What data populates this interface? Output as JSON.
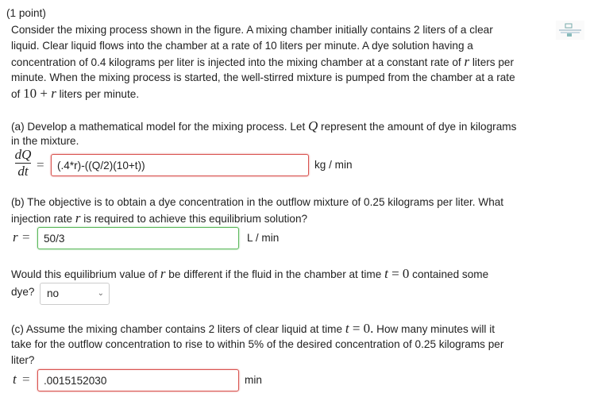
{
  "header": "(1 point)",
  "intro": [
    "Consider the mixing process shown in the figure. A mixing chamber initially contains 2 liters of a clear",
    "liquid. Clear liquid flows into the chamber at a rate of 10 liters per minute. A dye solution having a",
    "concentration of 0.4 kilograms per liter is injected into the mixing chamber at a constant rate of",
    "r",
    " liters per",
    "minute. When the mixing process is started, the well-stirred mixture is pumped from the chamber at a rate",
    "of ",
    "10 + ",
    "r",
    " liters per minute."
  ],
  "part_a": {
    "line1_pre": "(a) Develop a mathematical model for the mixing process. Let ",
    "Q": "Q",
    "line1_post": " represent the amount of dye in kilograms",
    "line2": "in the mixture.",
    "frac_num": "dQ",
    "frac_den": "dt",
    "equals": "=",
    "answer": "(.4*r)-((Q/2)(10+t))",
    "unit": "kg / min"
  },
  "part_b": {
    "line1": "(b) The objective is to obtain a dye concentration in the outflow mixture of 0.25 kilograms per liter. What",
    "line2_pre": "injection rate ",
    "line2_r": "r",
    "line2_post": " is required to achieve this equilibrium solution?",
    "var": "r",
    "equals": "=",
    "answer": "50/3",
    "unit": "L / min"
  },
  "part_q": {
    "line1_pre": "Would this equilibrium value of ",
    "r": "r",
    "line1_mid": " be different if the fluid in the chamber at time ",
    "t": "t",
    "eq": " = ",
    "zero": "0",
    "line1_post": " contained some",
    "line2": "dye?",
    "select_value": "no"
  },
  "part_c": {
    "line1_pre": "(c) Assume the mixing chamber contains 2 liters of clear liquid at time ",
    "t": "t",
    "eq": " = ",
    "zero": "0.",
    "line1_post": " How many minutes will it",
    "line2": "take for the outflow concentration to rise to within 5% of the desired concentration of 0.25 kilograms per",
    "line3": "liter?",
    "var": "t",
    "equals": "=",
    "answer": ".0015152030",
    "unit": "min"
  }
}
